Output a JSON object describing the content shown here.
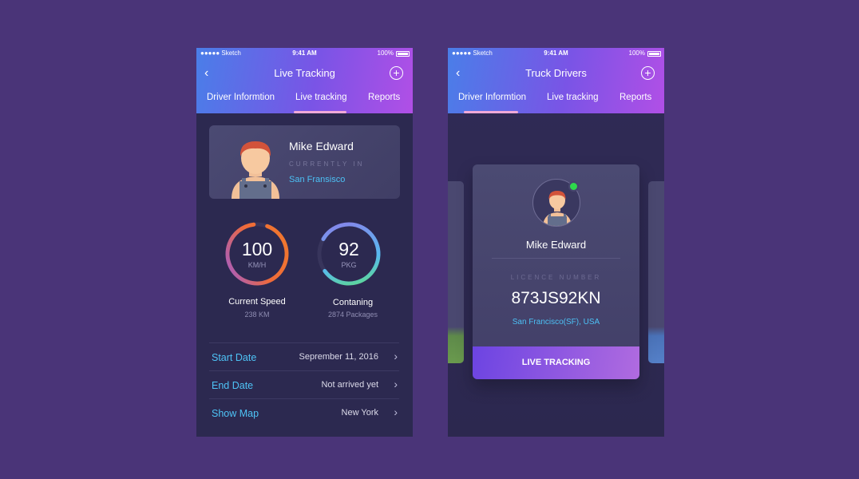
{
  "status": {
    "carrier": "●●●●● Sketch",
    "time": "9:41 AM",
    "battery": "100%"
  },
  "phone1": {
    "title": "Live Tracking",
    "tabs": [
      {
        "label": "Driver Informtion"
      },
      {
        "label": "Live tracking"
      },
      {
        "label": "Reports"
      }
    ],
    "active_tab": "Live tracking",
    "profile": {
      "name": "Mike Edward",
      "status_label": "CURRENTLY IN",
      "city": "San Fransisco"
    },
    "speed": {
      "value": "100",
      "unit": "KM/H",
      "label": "Current Speed",
      "sub": "238 KM"
    },
    "packages": {
      "value": "92",
      "unit": "PKG",
      "label": "Contaning",
      "sub": "2874 Packages"
    },
    "rows": [
      {
        "label": "Start Date",
        "value": "Seprember 11, 2016"
      },
      {
        "label": "End Date",
        "value": "Not arrived yet"
      },
      {
        "label": "Show Map",
        "value": "New York"
      }
    ]
  },
  "phone2": {
    "title": "Truck Drivers",
    "tabs": [
      {
        "label": "Driver Informtion"
      },
      {
        "label": "Live tracking"
      },
      {
        "label": "Reports"
      }
    ],
    "active_tab": "Driver Informtion",
    "card": {
      "name": "Mike Edward",
      "licence_label": "LICENCE NUMBER",
      "licence_number": "873JS92KN",
      "location": "San Francisco(SF), USA",
      "button": "LIVE TRACKING",
      "online": true
    }
  },
  "colors": {
    "accent_blue": "#4cc1f5",
    "online_green": "#2ed94b",
    "background": "#4a3478"
  }
}
